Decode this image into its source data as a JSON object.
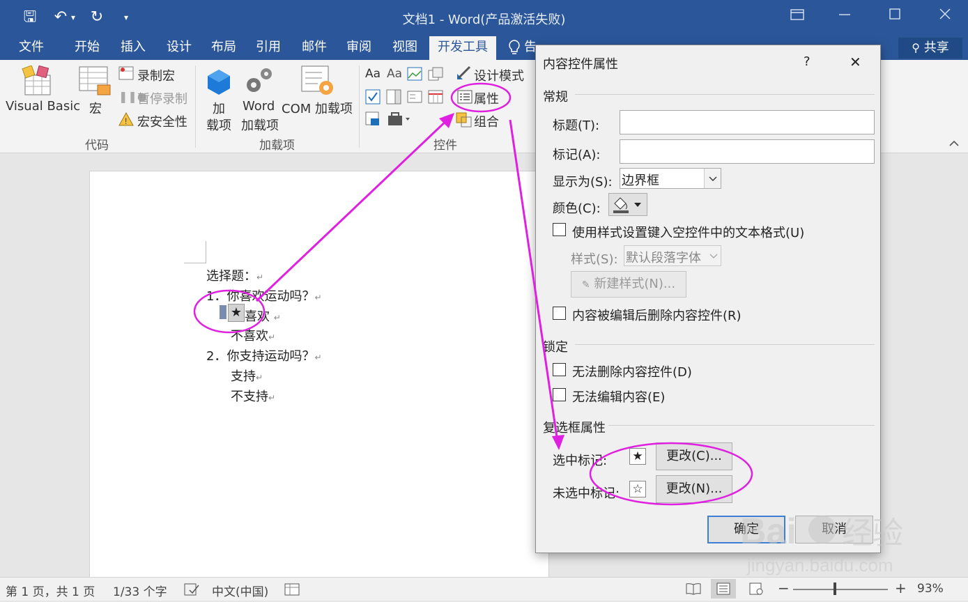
{
  "window": {
    "title": "文档1 - Word(产品激活失败)"
  },
  "quick_access": {
    "save": "🖫",
    "undo": "↶",
    "undo_dd": "▾",
    "redo": "↻",
    "customize": "▾"
  },
  "tabs": [
    "文件",
    "开始",
    "插入",
    "设计",
    "布局",
    "引用",
    "邮件",
    "审阅",
    "视图",
    "开发工具"
  ],
  "tell_me": "告诉我您想要做什么",
  "share": "共享",
  "ribbon": {
    "code": {
      "visual_basic": "Visual Basic",
      "macro": "宏",
      "record_macro": "录制宏",
      "pause_recording": "暂停录制",
      "macro_security": "宏安全性",
      "group": "代码"
    },
    "addins": {
      "addins_1": "加",
      "addins_2": "载项",
      "word_addins_1": "Word",
      "word_addins_2": "加载项",
      "com_addins": "COM 加载项",
      "group": "加载项"
    },
    "controls": {
      "design_mode": "设计模式",
      "properties": "属性",
      "group_btn": "组合",
      "group": "控件",
      "aa1": "Aa",
      "aa2": "Aa"
    }
  },
  "document": {
    "lines": [
      "选择题：",
      "1．你喜欢运动吗？",
      "喜欢",
      "不喜欢",
      "2．你支持运动吗？",
      "支持",
      "不支持"
    ],
    "para_mark": "↵",
    "checkbox_symbol": "★"
  },
  "status": {
    "page": "第 1 页，共 1 页",
    "words": "1/33 个字",
    "language": "中文(中国)",
    "zoom": "93%",
    "minus": "−",
    "plus": "+"
  },
  "dialog": {
    "title": "内容控件属性",
    "help": "?",
    "close": "✕",
    "general": "常规",
    "title_label": "标题(T):",
    "title_value": "",
    "tag_label": "标记(A):",
    "tag_value": "",
    "show_as_label": "显示为(S):",
    "show_as_value": "边界框",
    "color_label": "颜色(C):",
    "use_style": "使用样式设置键入空控件中的文本格式(U)",
    "style_label": "样式(S):",
    "style_value": "默认段落字体",
    "new_style": "新建样式(N)...",
    "remove_after_edit": "内容被编辑后删除内容控件(R)",
    "locking": "锁定",
    "cannot_delete": "无法删除内容控件(D)",
    "cannot_edit": "无法编辑内容(E)",
    "checkbox_props": "复选框属性",
    "checked_label": "选中标记:",
    "checked_symbol": "★",
    "change_checked": "更改(C)...",
    "unchecked_label": "未选中标记:",
    "unchecked_symbol": "☆",
    "change_unchecked": "更改(N)...",
    "ok": "确定",
    "cancel": "取消"
  },
  "colors": {
    "word_blue": "#2b579a",
    "annotation": "#e020e0"
  }
}
